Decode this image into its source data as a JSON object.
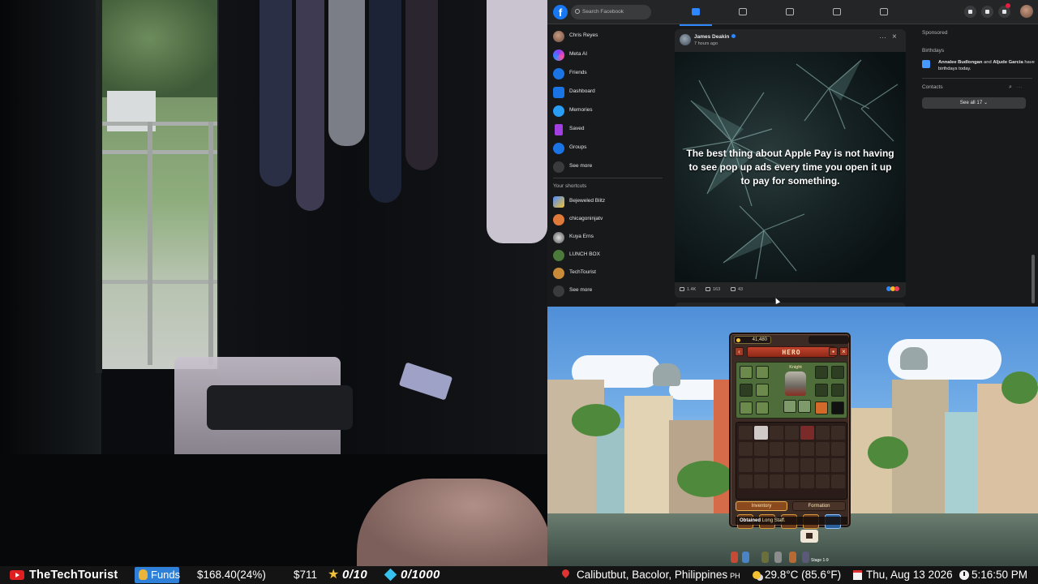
{
  "facebook": {
    "search_placeholder": "Search Facebook",
    "left_nav": [
      {
        "label": "Chris Reyes",
        "icon": "profile-avatar-icon"
      },
      {
        "label": "Meta AI",
        "icon": "meta-ai-icon"
      },
      {
        "label": "Friends",
        "icon": "friends-icon"
      },
      {
        "label": "Dashboard",
        "icon": "dashboard-icon"
      },
      {
        "label": "Memories",
        "icon": "memories-icon"
      },
      {
        "label": "Saved",
        "icon": "saved-icon"
      },
      {
        "label": "Groups",
        "icon": "groups-icon"
      },
      {
        "label": "See more",
        "icon": "chevron-down-icon"
      }
    ],
    "shortcuts_header": "Your shortcuts",
    "shortcuts": [
      {
        "label": "Bejeweled Blitz",
        "icon": "bejeweled-icon"
      },
      {
        "label": "chicagoninjatv",
        "icon": "chicagoninjatv-icon"
      },
      {
        "label": "Kuya Erns",
        "icon": "kuya-erns-icon"
      },
      {
        "label": "LUNCH BOX",
        "icon": "lunch-box-icon"
      },
      {
        "label": "TechTourist",
        "icon": "techtourist-icon"
      },
      {
        "label": "See more",
        "icon": "chevron-down-icon"
      }
    ],
    "post": {
      "author": "James Deakin",
      "time": "7 hours ago",
      "caption": "The best thing about Apple Pay is not having to see pop up ads every time you open it up to pay for something.",
      "likes": "1.4K",
      "comments": "163",
      "shares": "43"
    },
    "right_panel": {
      "sponsored": "Sponsored",
      "birthdays_header": "Birthdays",
      "birthday_name1": "Annalee Budlongan",
      "birthday_and": " and ",
      "birthday_name2": "Aljude Garcia",
      "birthday_suffix": " have birthdays today.",
      "contacts_header": "Contacts",
      "see_all": "See all 17"
    }
  },
  "game": {
    "gold": "41,480",
    "title": "HERO",
    "hero_class": "Knight",
    "tab_inventory": "Inventory",
    "tab_formation": "Formation",
    "toast_prefix": "Obtained",
    "toast_item": " Long Staff.",
    "stage": "Stage 1-9"
  },
  "status_bar": {
    "channel": "TheTechTourist",
    "funds_label": "Funds",
    "funds_amount": "$168.40(24%)",
    "total": "$711",
    "stars": "0/10",
    "diamonds": "0/1000",
    "location": "Calibutbut, Bacolor, Philippines",
    "country_code": "PH",
    "temperature": "29.8°C (85.6°F)",
    "date": "Thu, Aug 13 2026",
    "time": "5:16:50 PM"
  },
  "colors": {
    "facebook_blue": "#1877f2",
    "facebook_bg": "#18191a",
    "funds_blue": "#2f80d8",
    "youtube_red": "#e02020",
    "hero_banner_red": "#c1432d"
  }
}
